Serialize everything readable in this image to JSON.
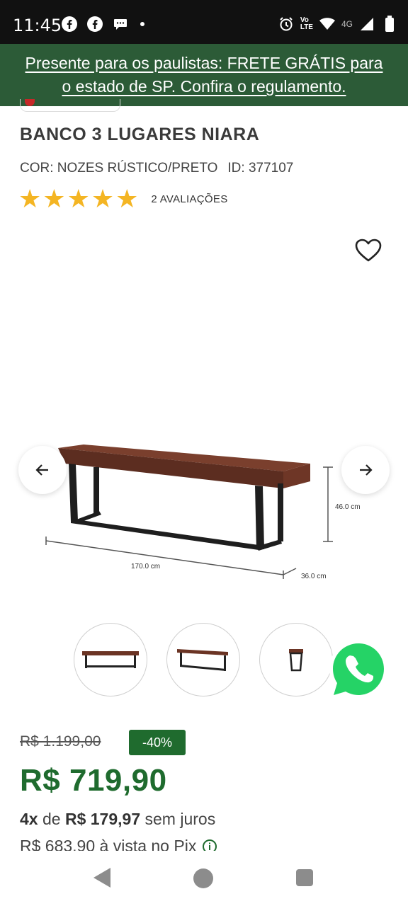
{
  "status_bar": {
    "time": "11:45",
    "left_icons": [
      "facebook-icon",
      "facebook-icon",
      "chat-icon"
    ],
    "right_icons": [
      "alarm-icon",
      "volte-icon",
      "wifi-icon",
      "signal-icon",
      "battery-icon"
    ],
    "network": "4G",
    "volte_top": "Vo",
    "volte_bottom": "LTE"
  },
  "banner": {
    "line1": "Presente para os paulistas: FRETE GRÁTIS para",
    "line2": "o estado de SP. Confira o regulamento."
  },
  "product": {
    "title": "BANCO 3 LUGARES NIARA",
    "color": "COR: NOZES RÚSTICO/PRETO",
    "id": "ID: 377107",
    "rating": 5,
    "reviews": "2 AVALIAÇÕES"
  },
  "gallery": {
    "dim_height": "46.0 cm",
    "dim_length": "170.0 cm",
    "dim_depth": "36.0 cm",
    "thumbnail_count": 3
  },
  "pricing": {
    "old_price": "R$ 1.199,00",
    "discount": "-40%",
    "price": "R$ 719,90",
    "installments_prefix": "4x",
    "installments_de": "de",
    "installments_value": "R$ 179,97",
    "installments_suffix": "sem juros",
    "pix_text": "R$ 683,90 à vista no Pix"
  },
  "colors": {
    "brand_green": "#1f6b2e",
    "banner_green": "#2c5b37",
    "star": "#f4b523",
    "whatsapp": "#25d366"
  }
}
